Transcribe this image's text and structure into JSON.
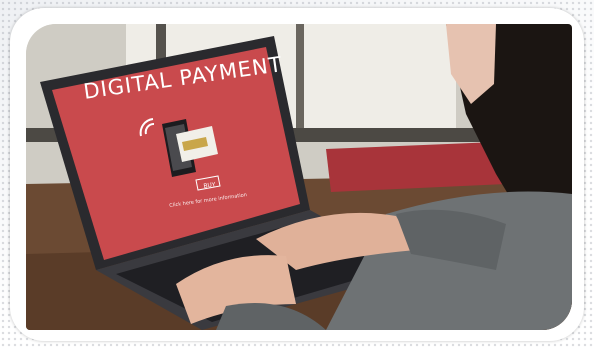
{
  "screen": {
    "headline": "DIGITAL PAYMENT",
    "button_label": "BUY",
    "caption": "Click here for more information"
  },
  "colors": {
    "screen_red": "#c94a4d",
    "frame_white": "#ffffff",
    "laptop_body": "#2b2b2f",
    "sweater": "#6e7274",
    "skin": "#e0b199",
    "window_light": "#e9e6df"
  },
  "icons": [
    "wireless-signal-icon",
    "smartphone-icon",
    "credit-card-icon"
  ]
}
